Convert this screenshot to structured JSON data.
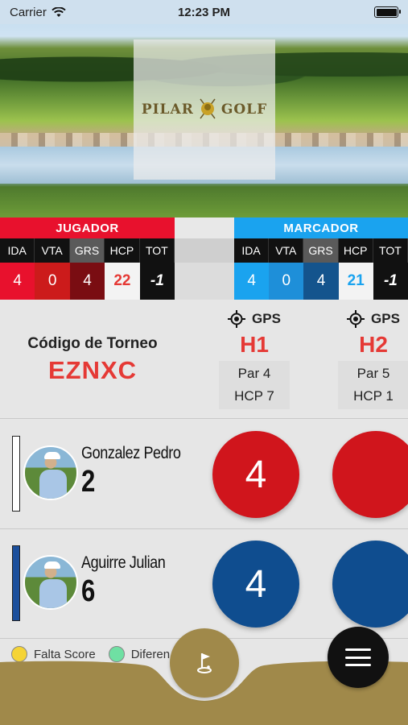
{
  "status_bar": {
    "carrier": "Carrier",
    "time": "12:23 PM"
  },
  "hero": {
    "logo_left": "PILAR",
    "logo_right": "GOLF"
  },
  "jugador": {
    "title": "JUGADOR",
    "color": "#e8112d",
    "columns": [
      "IDA",
      "VTA",
      "GRS",
      "HCP",
      "TOT"
    ],
    "values": [
      "4",
      "0",
      "4",
      "22",
      "-1"
    ]
  },
  "marcador": {
    "title": "MARCADOR",
    "color": "#1aa3ef",
    "columns": [
      "IDA",
      "VTA",
      "GRS",
      "HCP",
      "TOT"
    ],
    "values": [
      "4",
      "0",
      "4",
      "21",
      "-1"
    ]
  },
  "tournament": {
    "label": "Código de Torneo",
    "code": "EZNXC"
  },
  "holes": [
    {
      "gps": "GPS",
      "name": "H1",
      "par": "Par 4",
      "hcp": "HCP 7"
    },
    {
      "gps": "GPS",
      "name": "H2",
      "par": "Par 5",
      "hcp": "HCP 1"
    }
  ],
  "players": [
    {
      "name": "Gonzalez Pedro",
      "handicap": "2",
      "bar_color": "#ffffff",
      "scores": [
        "4",
        ""
      ],
      "score_color": "#d0151c"
    },
    {
      "name": "Aguirre Julian",
      "handicap": "6",
      "bar_color": "#1b4f9c",
      "scores": [
        "4",
        ""
      ],
      "score_color": "#0f4d8f"
    }
  ],
  "legend": [
    {
      "label": "Falta Score",
      "color": "#f5d436"
    },
    {
      "label": "Diferen",
      "color": "#6fe0a3"
    }
  ],
  "colors": {
    "accent_red": "#e53935",
    "bottom_bar": "#a0894a"
  },
  "icons": [
    "wifi-icon",
    "battery-icon",
    "gps-target-icon",
    "golf-flag-icon",
    "menu-icon"
  ]
}
